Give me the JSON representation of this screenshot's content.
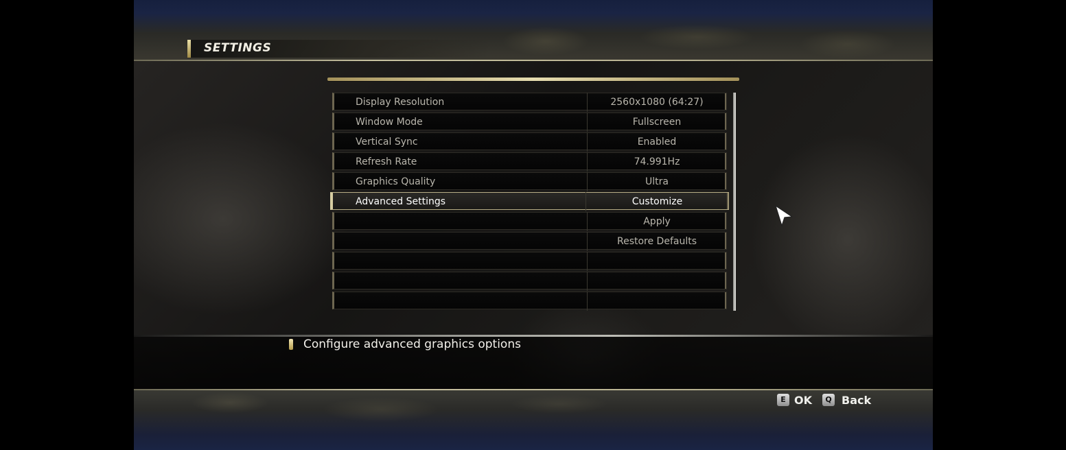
{
  "header": {
    "title": "SETTINGS"
  },
  "settings": [
    {
      "label": "Display Resolution",
      "value": "2560x1080 (64:27)"
    },
    {
      "label": "Window Mode",
      "value": "Fullscreen"
    },
    {
      "label": "Vertical Sync",
      "value": "Enabled"
    },
    {
      "label": "Refresh Rate",
      "value": "74.991Hz"
    },
    {
      "label": "Graphics Quality",
      "value": "Ultra"
    },
    {
      "label": "Advanced Settings",
      "value": "Customize"
    },
    {
      "label": "",
      "value": "Apply"
    },
    {
      "label": "",
      "value": "Restore Defaults"
    },
    {
      "label": "",
      "value": ""
    },
    {
      "label": "",
      "value": ""
    },
    {
      "label": "",
      "value": ""
    }
  ],
  "selected_index": 5,
  "description": "Configure advanced graphics options",
  "footer": {
    "ok_key": "E",
    "ok_label": "OK",
    "back_key": "Q",
    "back_label": "Back"
  },
  "colors": {
    "accent_gold": "#d7cda2",
    "scrollbar": "#e6e6e2",
    "text": "#b9b6ac",
    "text_selected": "#ffffff"
  }
}
